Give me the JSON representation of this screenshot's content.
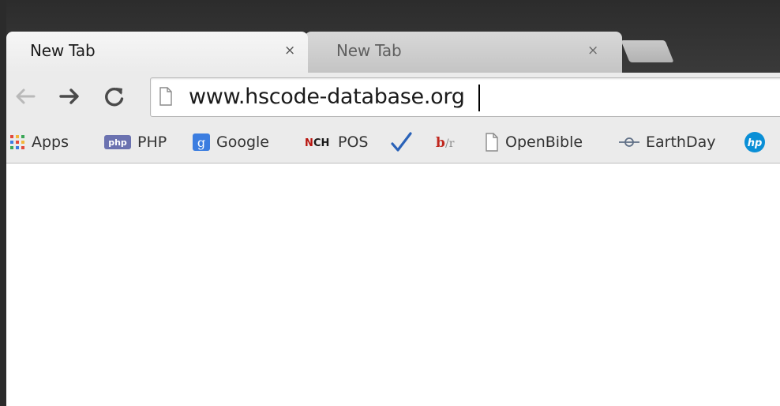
{
  "tabs": [
    {
      "label": "New Tab",
      "active": true
    },
    {
      "label": "New Tab",
      "active": false
    }
  ],
  "tab_close_glyph": "×",
  "toolbar": {
    "back": "back-arrow-icon",
    "forward": "forward-arrow-icon",
    "reload": "reload-icon"
  },
  "omnibox": {
    "value": "www.hscode-database.org",
    "icon": "page-icon"
  },
  "bookmarks": [
    {
      "label": "Apps",
      "icon": "apps-grid-icon"
    },
    {
      "label": "PHP",
      "icon": "php-logo-icon"
    },
    {
      "label": "Google",
      "icon": "google-icon"
    },
    {
      "label": "POS",
      "icon": "nch-logo-icon"
    },
    {
      "label": "",
      "icon": "checkmark-icon"
    },
    {
      "label": "",
      "icon": "br-logo-icon"
    },
    {
      "label": "OpenBible",
      "icon": "page-icon"
    },
    {
      "label": "EarthDay",
      "icon": "earthday-icon"
    },
    {
      "label": "",
      "icon": "hp-logo-icon"
    }
  ],
  "colors": {
    "tabstrip": "#2c2c2c",
    "toolbar": "#ebebeb",
    "google_blue": "#3b7de0",
    "hp_blue": "#0a8fd6"
  }
}
